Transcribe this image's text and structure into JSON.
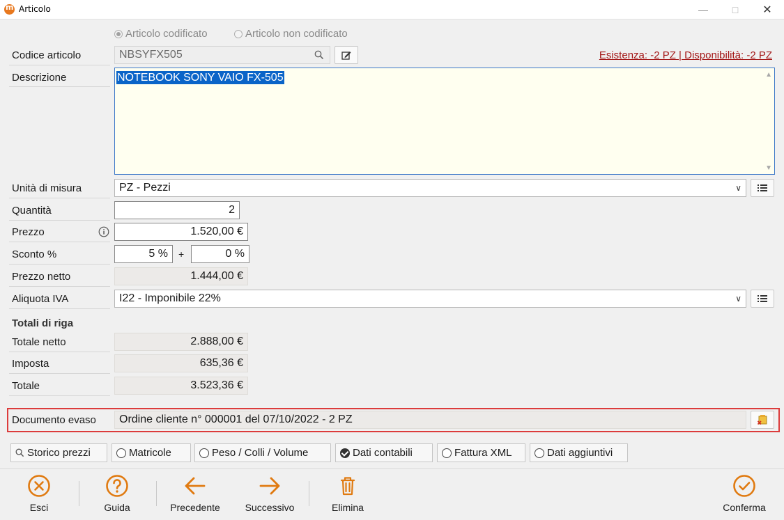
{
  "window": {
    "title": "Articolo"
  },
  "mode": {
    "option_codificato": "Articolo codificato",
    "option_non_codificato": "Articolo non codificato"
  },
  "form": {
    "codice_label": "Codice articolo",
    "codice_value": "NBSYFX505",
    "availability_link": "Esistenza: -2 PZ | Disponibilità: -2 PZ",
    "descrizione_label": "Descrizione",
    "descrizione_value": "NOTEBOOK SONY VAIO FX-505",
    "unita_label": "Unità di misura",
    "unita_value": "PZ - Pezzi",
    "quantita_label": "Quantità",
    "quantita_value": "2",
    "prezzo_label": "Prezzo",
    "prezzo_value": "1.520,00 €",
    "sconto_label": "Sconto %",
    "sconto1_value": "5 %",
    "sconto_plus": "+",
    "sconto2_value": "0 %",
    "prezzo_netto_label": "Prezzo netto",
    "prezzo_netto_value": "1.444,00 €",
    "iva_label": "Aliquota IVA",
    "iva_value": "I22 - Imponibile 22%"
  },
  "totali": {
    "title": "Totali di riga",
    "netto_label": "Totale netto",
    "netto_value": "2.888,00 €",
    "imposta_label": "Imposta",
    "imposta_value": "635,36 €",
    "totale_label": "Totale",
    "totale_value": "3.523,36 €"
  },
  "documento": {
    "label": "Documento evaso",
    "value": "Ordine cliente n° 000001 del 07/10/2022 - 2 PZ"
  },
  "tabs": [
    {
      "label": "Storico prezzi"
    },
    {
      "label": "Matricole"
    },
    {
      "label": "Peso / Colli / Volume"
    },
    {
      "label": "Dati contabili"
    },
    {
      "label": "Fattura XML"
    },
    {
      "label": "Dati aggiuntivi"
    }
  ],
  "toolbar": {
    "esci": "Esci",
    "guida": "Guida",
    "precedente": "Precedente",
    "successivo": "Successivo",
    "elimina": "Elimina",
    "conferma": "Conferma"
  },
  "colors": {
    "accent": "#e07a10",
    "link": "#a31515",
    "highlight_frame": "#dc3c3c",
    "selection": "#0a64c8"
  }
}
